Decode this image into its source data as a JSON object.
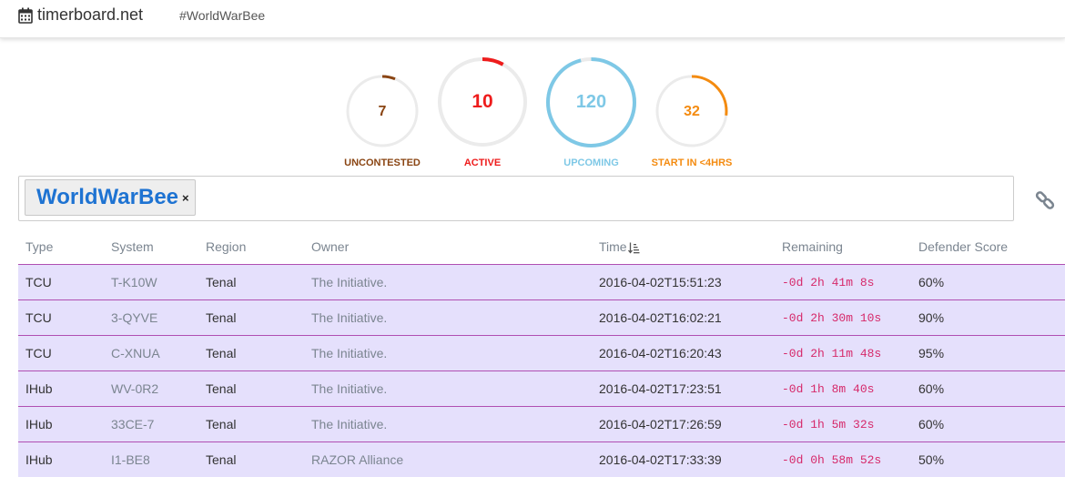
{
  "navbar": {
    "brand": "timerboard.net",
    "hashtag": "#WorldWarBee"
  },
  "gauges": [
    {
      "key": "uncontested",
      "value": "7",
      "label": "UNCONTESTED",
      "color": "#8a4513",
      "fraction": 0.06
    },
    {
      "key": "active",
      "value": "10",
      "label": "ACTIVE",
      "color": "#ee1c1c",
      "fraction": 0.08
    },
    {
      "key": "upcoming",
      "value": "120",
      "label": "UPCOMING",
      "color": "#7ec8e6",
      "fraction": 0.96
    },
    {
      "key": "start4",
      "value": "32",
      "label": "START IN <4HRS",
      "color": "#f48b10",
      "fraction": 0.27
    }
  ],
  "filter": {
    "tag": "WorldWarBee",
    "remove": "×"
  },
  "table": {
    "headers": [
      "Type",
      "System",
      "Region",
      "Owner",
      "Time",
      "Remaining",
      "Defender Score"
    ],
    "rows": [
      [
        "TCU",
        "T-K10W",
        "Tenal",
        "The Initiative.",
        "2016-04-02T15:51:23",
        "-0d 2h 41m 8s",
        "60%"
      ],
      [
        "TCU",
        "3-QYVE",
        "Tenal",
        "The Initiative.",
        "2016-04-02T16:02:21",
        "-0d 2h 30m 10s",
        "90%"
      ],
      [
        "TCU",
        "C-XNUA",
        "Tenal",
        "The Initiative.",
        "2016-04-02T16:20:43",
        "-0d 2h 11m 48s",
        "95%"
      ],
      [
        "IHub",
        "WV-0R2",
        "Tenal",
        "The Initiative.",
        "2016-04-02T17:23:51",
        "-0d 1h 8m 40s",
        "60%"
      ],
      [
        "IHub",
        "33CE-7",
        "Tenal",
        "The Initiative.",
        "2016-04-02T17:26:59",
        "-0d 1h 5m 32s",
        "60%"
      ],
      [
        "IHub",
        "I1-BE8",
        "Tenal",
        "RAZOR Alliance",
        "2016-04-02T17:33:39",
        "-0d 0h 58m 52s",
        "50%"
      ]
    ]
  },
  "icons": {
    "brand": "calendar-icon",
    "sort": "sort-amount-icon",
    "link": "link-icon",
    "remove": "close-icon"
  }
}
